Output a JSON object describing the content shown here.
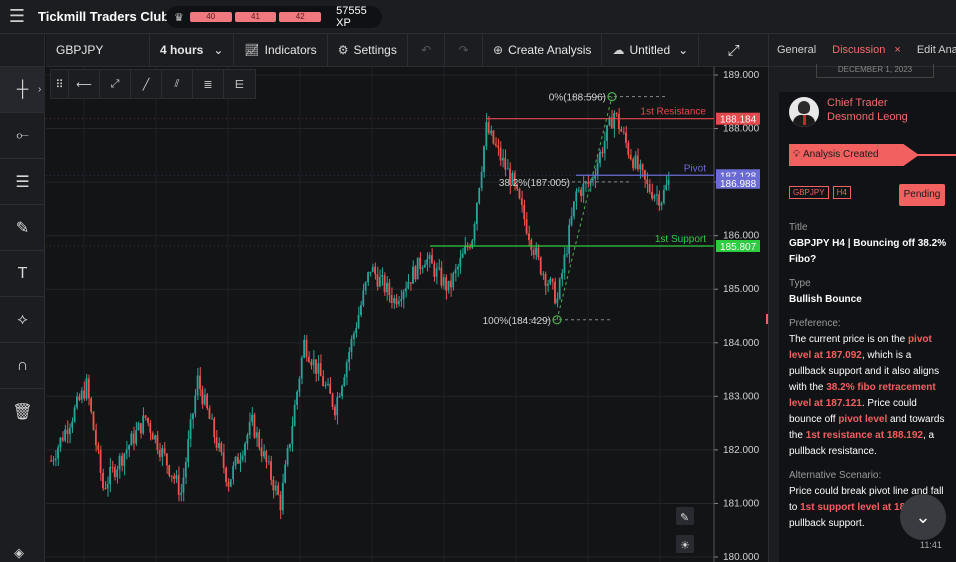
{
  "app": {
    "title": "Tickmill Traders Club",
    "xp_segments": [
      "40",
      "41",
      "42"
    ],
    "xp_total": "57555 XP"
  },
  "toolbar": {
    "symbol": "GBPJPY",
    "timeframe": "4 hours",
    "indicators": "Indicators",
    "settings": "Settings",
    "create_analysis": "Create Analysis",
    "layout_name": "Untitled"
  },
  "chart_data": {
    "type": "candlestick",
    "symbol": "GBPJPY",
    "timeframe": "4 hours",
    "ylim": [
      180.0,
      189.0
    ],
    "y_ticks": [
      "189.000",
      "188.000",
      "187.000",
      "186.000",
      "185.000",
      "184.000",
      "183.000",
      "182.000",
      "181.000",
      "180.000"
    ],
    "levels": [
      {
        "name": "1st Resistance",
        "value": 188.184,
        "label": "188.184",
        "color": "#e5484d"
      },
      {
        "name": "Pivot",
        "value": 187.128,
        "label": "187.128",
        "color": "#6b6bd6"
      },
      {
        "name": "",
        "value": 186.988,
        "label": "186.988",
        "color": "#6b6bd6"
      },
      {
        "name": "1st Support",
        "value": 185.807,
        "label": "185.807",
        "color": "#2ecc40"
      }
    ],
    "fibonacci": [
      {
        "label": "0%(188.596)",
        "value": 188.596
      },
      {
        "label": "38.2%(187.005)",
        "value": 187.005
      },
      {
        "label": "100%(184.429)",
        "value": 184.429
      }
    ]
  },
  "panel": {
    "tabs": [
      "General",
      "Discussion",
      "Edit Analys"
    ],
    "active_tab": "Discussion",
    "date": "DECEMBER 1, 2023",
    "author_role": "Chief Trader",
    "author_name": "Desmond Leong",
    "status_flag": "Analysis Created",
    "tags": [
      "GBPJPY",
      "H4"
    ],
    "status": "Pending",
    "title_label": "Title",
    "title": "GBPJPY H4 | Bouncing off 38.2% Fibo?",
    "type_label": "Type",
    "type": "Bullish Bounce",
    "preference_label": "Preference:",
    "pref": {
      "t1": "The current price is on the ",
      "h1": "pivot level at 187.092",
      "t2": ", which is a pullback support and it also aligns with the ",
      "h2": "38.2% fibo retracement level at 187.121",
      "t3": ". Price could bounce off ",
      "h3": "pivot level",
      "t4": " and towards the ",
      "h4": "1st resistance at 188.192",
      "t5": ", a pullback resistance."
    },
    "alt_label": "Alternative Scenario:",
    "alt": {
      "t1": "Price could break pivot line and fall to ",
      "h1": "1st support level at 185.8",
      "t2": " pullback support."
    },
    "time": "11:41"
  }
}
